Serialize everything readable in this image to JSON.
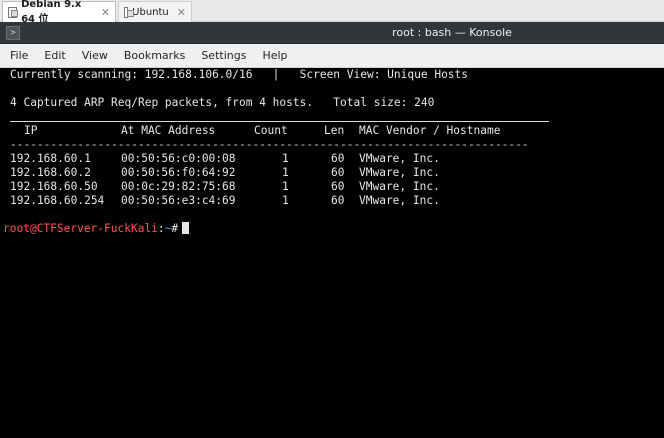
{
  "vm_tabs": [
    {
      "label": "Debian 9.x 64 位",
      "active": true
    },
    {
      "label": "Ubuntu",
      "active": false
    }
  ],
  "window": {
    "title": "root : bash — Konsole"
  },
  "menu": [
    "File",
    "Edit",
    "View",
    "Bookmarks",
    "Settings",
    "Help"
  ],
  "terminal": {
    "scan_line": "Currently scanning: 192.168.106.0/16   |   Screen View: Unique Hosts",
    "summary_line": "4 Captured ARP Req/Rep packets, from 4 hosts.   Total size: 240",
    "headers": [
      "IP",
      "At MAC Address",
      "Count",
      "Len",
      "MAC Vendor / Hostname"
    ],
    "separator": "-----------------------------------------------------------------------------",
    "rows": [
      {
        "ip": "192.168.60.1",
        "mac": "00:50:56:c0:00:08",
        "count": "1",
        "len": "60",
        "vendor": "VMware, Inc."
      },
      {
        "ip": "192.168.60.2",
        "mac": "00:50:56:f0:64:92",
        "count": "1",
        "len": "60",
        "vendor": "VMware, Inc."
      },
      {
        "ip": "192.168.60.50",
        "mac": "00:0c:29:82:75:68",
        "count": "1",
        "len": "60",
        "vendor": "VMware, Inc."
      },
      {
        "ip": "192.168.60.254",
        "mac": "00:50:56:e3:c4:69",
        "count": "1",
        "len": "60",
        "vendor": "VMware, Inc."
      }
    ],
    "prompt": {
      "user_host": "root@CTFServer-FuckKali",
      "separator": ":",
      "path": "~",
      "symbol": "#"
    }
  }
}
